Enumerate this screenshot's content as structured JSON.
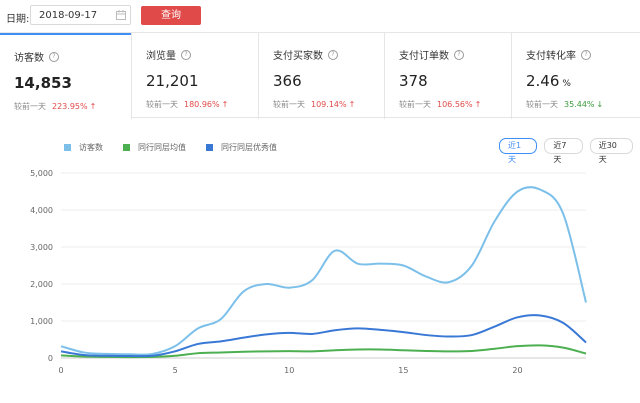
{
  "topbar": {
    "date_label": "日期:",
    "date_value": "2018-09-17",
    "query_label": "查询"
  },
  "metrics": [
    {
      "title": "访客数",
      "value": "14,853",
      "unit": "",
      "compare_label": "较前一天",
      "change": "223.95%",
      "direction": "up",
      "active": true
    },
    {
      "title": "浏览量",
      "value": "21,201",
      "unit": "",
      "compare_label": "较前一天",
      "change": "180.96%",
      "direction": "up",
      "active": false
    },
    {
      "title": "支付买家数",
      "value": "366",
      "unit": "",
      "compare_label": "较前一天",
      "change": "109.14%",
      "direction": "up",
      "active": false
    },
    {
      "title": "支付订单数",
      "value": "378",
      "unit": "",
      "compare_label": "较前一天",
      "change": "106.56%",
      "direction": "up",
      "active": false
    },
    {
      "title": "支付转化率",
      "value": "2.46",
      "unit": "%",
      "compare_label": "较前一天",
      "change": "35.44%",
      "direction": "down",
      "active": false
    }
  ],
  "range_buttons": [
    {
      "label": "近1天",
      "active": true
    },
    {
      "label": "近7天",
      "active": false
    },
    {
      "label": "近30天",
      "active": false
    }
  ],
  "chart_data": {
    "type": "line",
    "x": [
      0,
      1,
      2,
      3,
      4,
      5,
      6,
      7,
      8,
      9,
      10,
      11,
      12,
      13,
      14,
      15,
      16,
      17,
      18,
      19,
      20,
      21,
      22,
      23
    ],
    "xticks": [
      0,
      5,
      10,
      15,
      20
    ],
    "yticks": [
      0,
      1000,
      2000,
      3000,
      4000,
      5000
    ],
    "ytick_labels": [
      "0",
      "1,000",
      "2,000",
      "3,000",
      "4,000",
      "5,000"
    ],
    "ylim": [
      0,
      5000
    ],
    "xlim": [
      0,
      23
    ],
    "legend_position": "top-left",
    "grid": true,
    "series": [
      {
        "name": "访客数",
        "color": "#7cc0ea",
        "values": [
          320,
          150,
          110,
          100,
          110,
          320,
          800,
          1050,
          1800,
          2000,
          1900,
          2100,
          2900,
          2550,
          2550,
          2500,
          2200,
          2050,
          2500,
          3700,
          4500,
          4550,
          3900,
          1500
        ]
      },
      {
        "name": "同行同层均值",
        "color": "#4caf50",
        "values": [
          70,
          40,
          30,
          25,
          30,
          60,
          130,
          150,
          170,
          180,
          185,
          180,
          210,
          230,
          230,
          210,
          190,
          180,
          190,
          250,
          320,
          340,
          280,
          120
        ]
      },
      {
        "name": "同行同层优秀值",
        "color": "#3a78d6",
        "values": [
          180,
          80,
          60,
          55,
          60,
          180,
          380,
          450,
          550,
          640,
          680,
          650,
          750,
          800,
          760,
          700,
          620,
          580,
          620,
          850,
          1100,
          1150,
          950,
          420
        ]
      }
    ]
  }
}
